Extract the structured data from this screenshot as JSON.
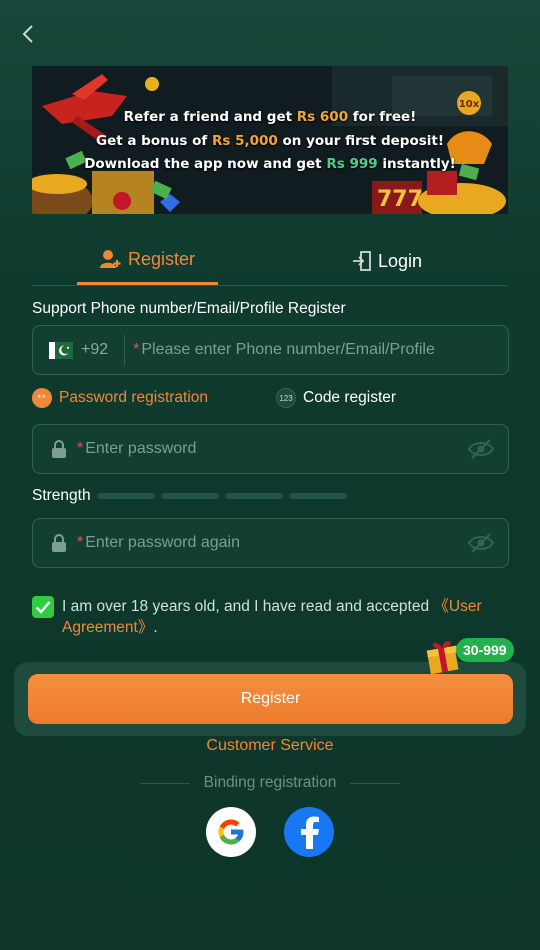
{
  "banner": {
    "line1_a": "Refer a friend and get ",
    "line1_b": "Rs 600",
    "line1_c": " for free!",
    "line2_a": "Get a bonus of ",
    "line2_b": "Rs 5,000",
    "line2_c": " on your first deposit!",
    "line3_a": "Download the app now and get ",
    "line3_b": "Rs 999",
    "line3_c": " instantly!"
  },
  "tabs": {
    "register": "Register",
    "login": "Login"
  },
  "form": {
    "support_label": "Support Phone number/Email/Profile Register",
    "country_code": "+92",
    "phone_placeholder": "Please enter Phone number/Email/Profile",
    "mode_password": "Password registration",
    "mode_code": "Code register",
    "password_placeholder": "Enter password",
    "strength_label": "Strength",
    "password_again_placeholder": "Enter password again",
    "required_mark": "*",
    "agree_text": "I am over 18 years old, and I have read and accepted ",
    "agree_link": "《User Agreement》",
    "agree_end": ".",
    "register_button": "Register",
    "badge": "30-999"
  },
  "footer": {
    "customer_service": "Customer Service",
    "binding": "Binding registration"
  },
  "colors": {
    "accent": "#f0883a",
    "background": "#0f3a2e",
    "check": "#2ecc40",
    "badge": "#22b14c"
  },
  "icons": [
    "chevron-left-icon",
    "user-plus-icon",
    "login-door-icon",
    "pakistan-flag-icon",
    "lock-icon",
    "eye-off-icon",
    "check-icon",
    "gift-icon",
    "google-icon",
    "facebook-icon"
  ]
}
